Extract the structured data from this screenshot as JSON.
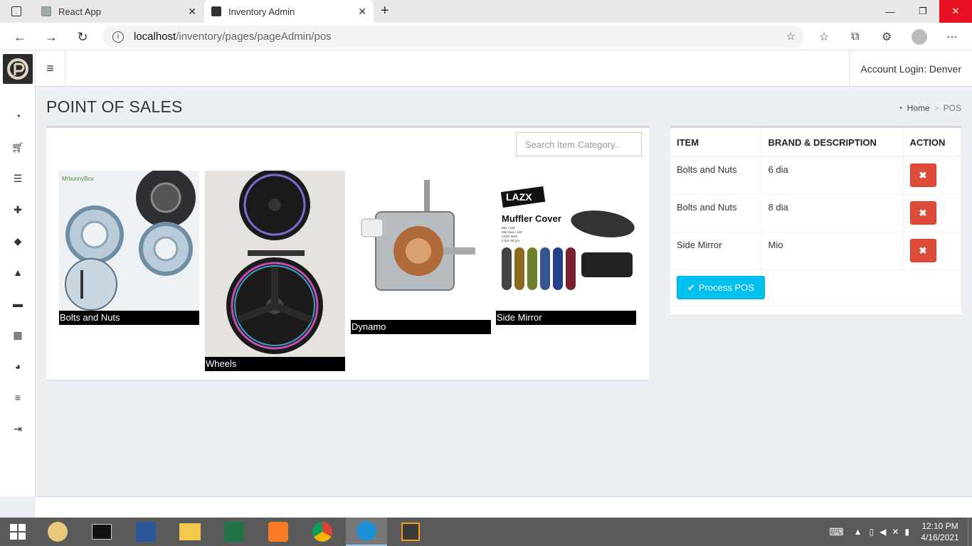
{
  "browser": {
    "tabs": [
      {
        "title": "React App"
      },
      {
        "title": "Inventory Admin"
      }
    ],
    "url_host": "localhost",
    "url_path": "/inventory/pages/pageAdmin/pos"
  },
  "header": {
    "account": "Account Login: Denver"
  },
  "page": {
    "title": "POINT OF SALES",
    "breadcrumb": {
      "home": "Home",
      "current": "POS"
    }
  },
  "search": {
    "placeholder": "Search Item Category.."
  },
  "products": [
    {
      "name": "Bolts and Nuts"
    },
    {
      "name": "Wheels"
    },
    {
      "name": "Dynamo"
    },
    {
      "name": "Side Mirror"
    }
  ],
  "product_image_text": {
    "brand_mark": "MrbunnyBox",
    "cover_brand": "LAZX",
    "cover_title": "Muffler Cover",
    "cover_lines": [
      "Mio I 125",
      "Mio Soul i 125",
      "LAZX 3561",
      "1 box 50 pcs"
    ]
  },
  "cart": {
    "headers": {
      "item": "ITEM",
      "brand": "BRAND & DESCRIPTION",
      "action": "ACTION"
    },
    "rows": [
      {
        "item": "Bolts and Nuts",
        "desc": "6 dia"
      },
      {
        "item": "Bolts and Nuts",
        "desc": "8 dia"
      },
      {
        "item": "Side Mirror",
        "desc": "Mio"
      }
    ],
    "process_label": "Process POS"
  },
  "taskbar": {
    "time": "12:10 PM",
    "date": "4/16/2021"
  },
  "colors": {
    "danger": "#dd4b39",
    "info": "#00c0ef",
    "content_bg": "#ecf0f5"
  }
}
